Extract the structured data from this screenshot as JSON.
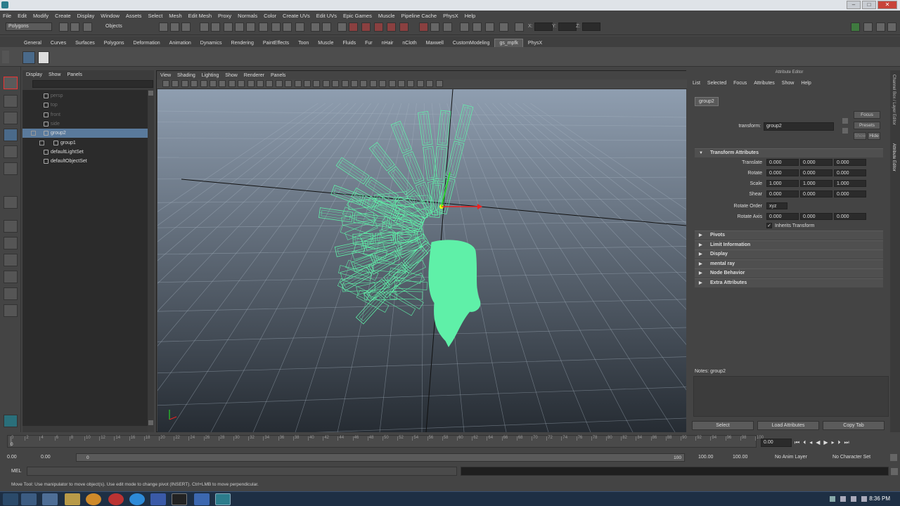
{
  "menus": [
    "File",
    "Edit",
    "Modify",
    "Create",
    "Display",
    "Window",
    "Assets",
    "Select",
    "Mesh",
    "Edit Mesh",
    "Proxy",
    "Normals",
    "Color",
    "Create UVs",
    "Edit UVs",
    "Epic Games",
    "Muscle",
    "Pipeline Cache",
    "PhysX",
    "Help"
  ],
  "status_line": {
    "mode": "Polygons",
    "select_label": "Objects",
    "x_label": "X:",
    "y_label": "Y:",
    "z_label": "Z:"
  },
  "shelf_tabs": [
    "General",
    "Curves",
    "Surfaces",
    "Polygons",
    "Deformation",
    "Animation",
    "Dynamics",
    "Rendering",
    "PaintEffects",
    "Toon",
    "Muscle",
    "Fluids",
    "Fur",
    "nHair",
    "nCloth",
    "Maxwell",
    "CustomModeling",
    "gs_mpfk",
    "PhysX"
  ],
  "outliner": {
    "menu": [
      "Display",
      "Show",
      "Panels"
    ],
    "items": [
      {
        "label": "persp",
        "state": "dim"
      },
      {
        "label": "top",
        "state": "dim"
      },
      {
        "label": "front",
        "state": "dim"
      },
      {
        "label": "side",
        "state": "dim"
      },
      {
        "label": "group2",
        "state": "selected"
      },
      {
        "label": "group1",
        "state": "child"
      },
      {
        "label": "defaultLightSet",
        "state": "normal"
      },
      {
        "label": "defaultObjectSet",
        "state": "normal"
      }
    ]
  },
  "viewport": {
    "menu": [
      "View",
      "Shading",
      "Lighting",
      "Show",
      "Renderer",
      "Panels"
    ]
  },
  "attribute_editor": {
    "title": "Attribute Editor",
    "menu": [
      "List",
      "Selected",
      "Focus",
      "Attributes",
      "Show",
      "Help"
    ],
    "node_tab": "group2",
    "transform_label": "transform:",
    "transform_value": "group2",
    "focus_label": "Focus",
    "presets_label": "Presets",
    "show_label": "Show",
    "hide_label": "Hide",
    "section_transform": "Transform Attributes",
    "translate_label": "Translate",
    "translate": [
      "0.000",
      "0.000",
      "0.000"
    ],
    "rotate_label": "Rotate",
    "rotate": [
      "0.000",
      "0.000",
      "0.000"
    ],
    "scale_label": "Scale",
    "scale": [
      "1.000",
      "1.000",
      "1.000"
    ],
    "shear_label": "Shear",
    "shear": [
      "0.000",
      "0.000",
      "0.000"
    ],
    "rotate_order_label": "Rotate Order",
    "rotate_order": "xyz",
    "rotate_axis_label": "Rotate Axis",
    "rotate_axis": [
      "0.000",
      "0.000",
      "0.000"
    ],
    "inherits_label": "Inherits Transform",
    "inherits_check": "✓",
    "sections": [
      "Pivots",
      "Limit Information",
      "Display",
      "mental ray",
      "Node Behavior",
      "Extra Attributes"
    ],
    "notes_label": "Notes:  group2",
    "buttons": [
      "Select",
      "Load Attributes",
      "Copy Tab"
    ]
  },
  "side_tabs": {
    "channel_box": "Channel Box / Layer Editor",
    "attr_editor": "Attribute Editor"
  },
  "time_slider": {
    "ticks": [
      "0",
      "2",
      "4",
      "6",
      "8",
      "10",
      "12",
      "14",
      "16",
      "18",
      "20",
      "22",
      "24",
      "26",
      "28",
      "30",
      "32",
      "34",
      "36",
      "38",
      "40",
      "42",
      "44",
      "46",
      "48",
      "50",
      "52",
      "54",
      "56",
      "58",
      "60",
      "62",
      "64",
      "66",
      "68",
      "70",
      "72",
      "74",
      "76",
      "78",
      "80",
      "82",
      "84",
      "86",
      "88",
      "90",
      "92",
      "94",
      "96",
      "98",
      "100"
    ],
    "frame_left": "0",
    "current": "0.00"
  },
  "range": {
    "start": "0.00",
    "start2": "0.00",
    "slider_start": "0",
    "slider_end": "100",
    "end": "100.00",
    "end2": "100.00",
    "anim_layer": "No Anim Layer",
    "character_set": "No Character Set"
  },
  "mel_label": "MEL",
  "help_line": "Move Tool: Use manipulator to move object(s). Use edit mode to change pivot (INSERT). Ctrl+LMB to move perpendicular.",
  "clock": "8:36 PM",
  "colors": {
    "wire": "#5ff0a8",
    "selection": "#5a7a9c",
    "bg_top": "#8f9eb0",
    "bg_bottom": "#262c33"
  }
}
